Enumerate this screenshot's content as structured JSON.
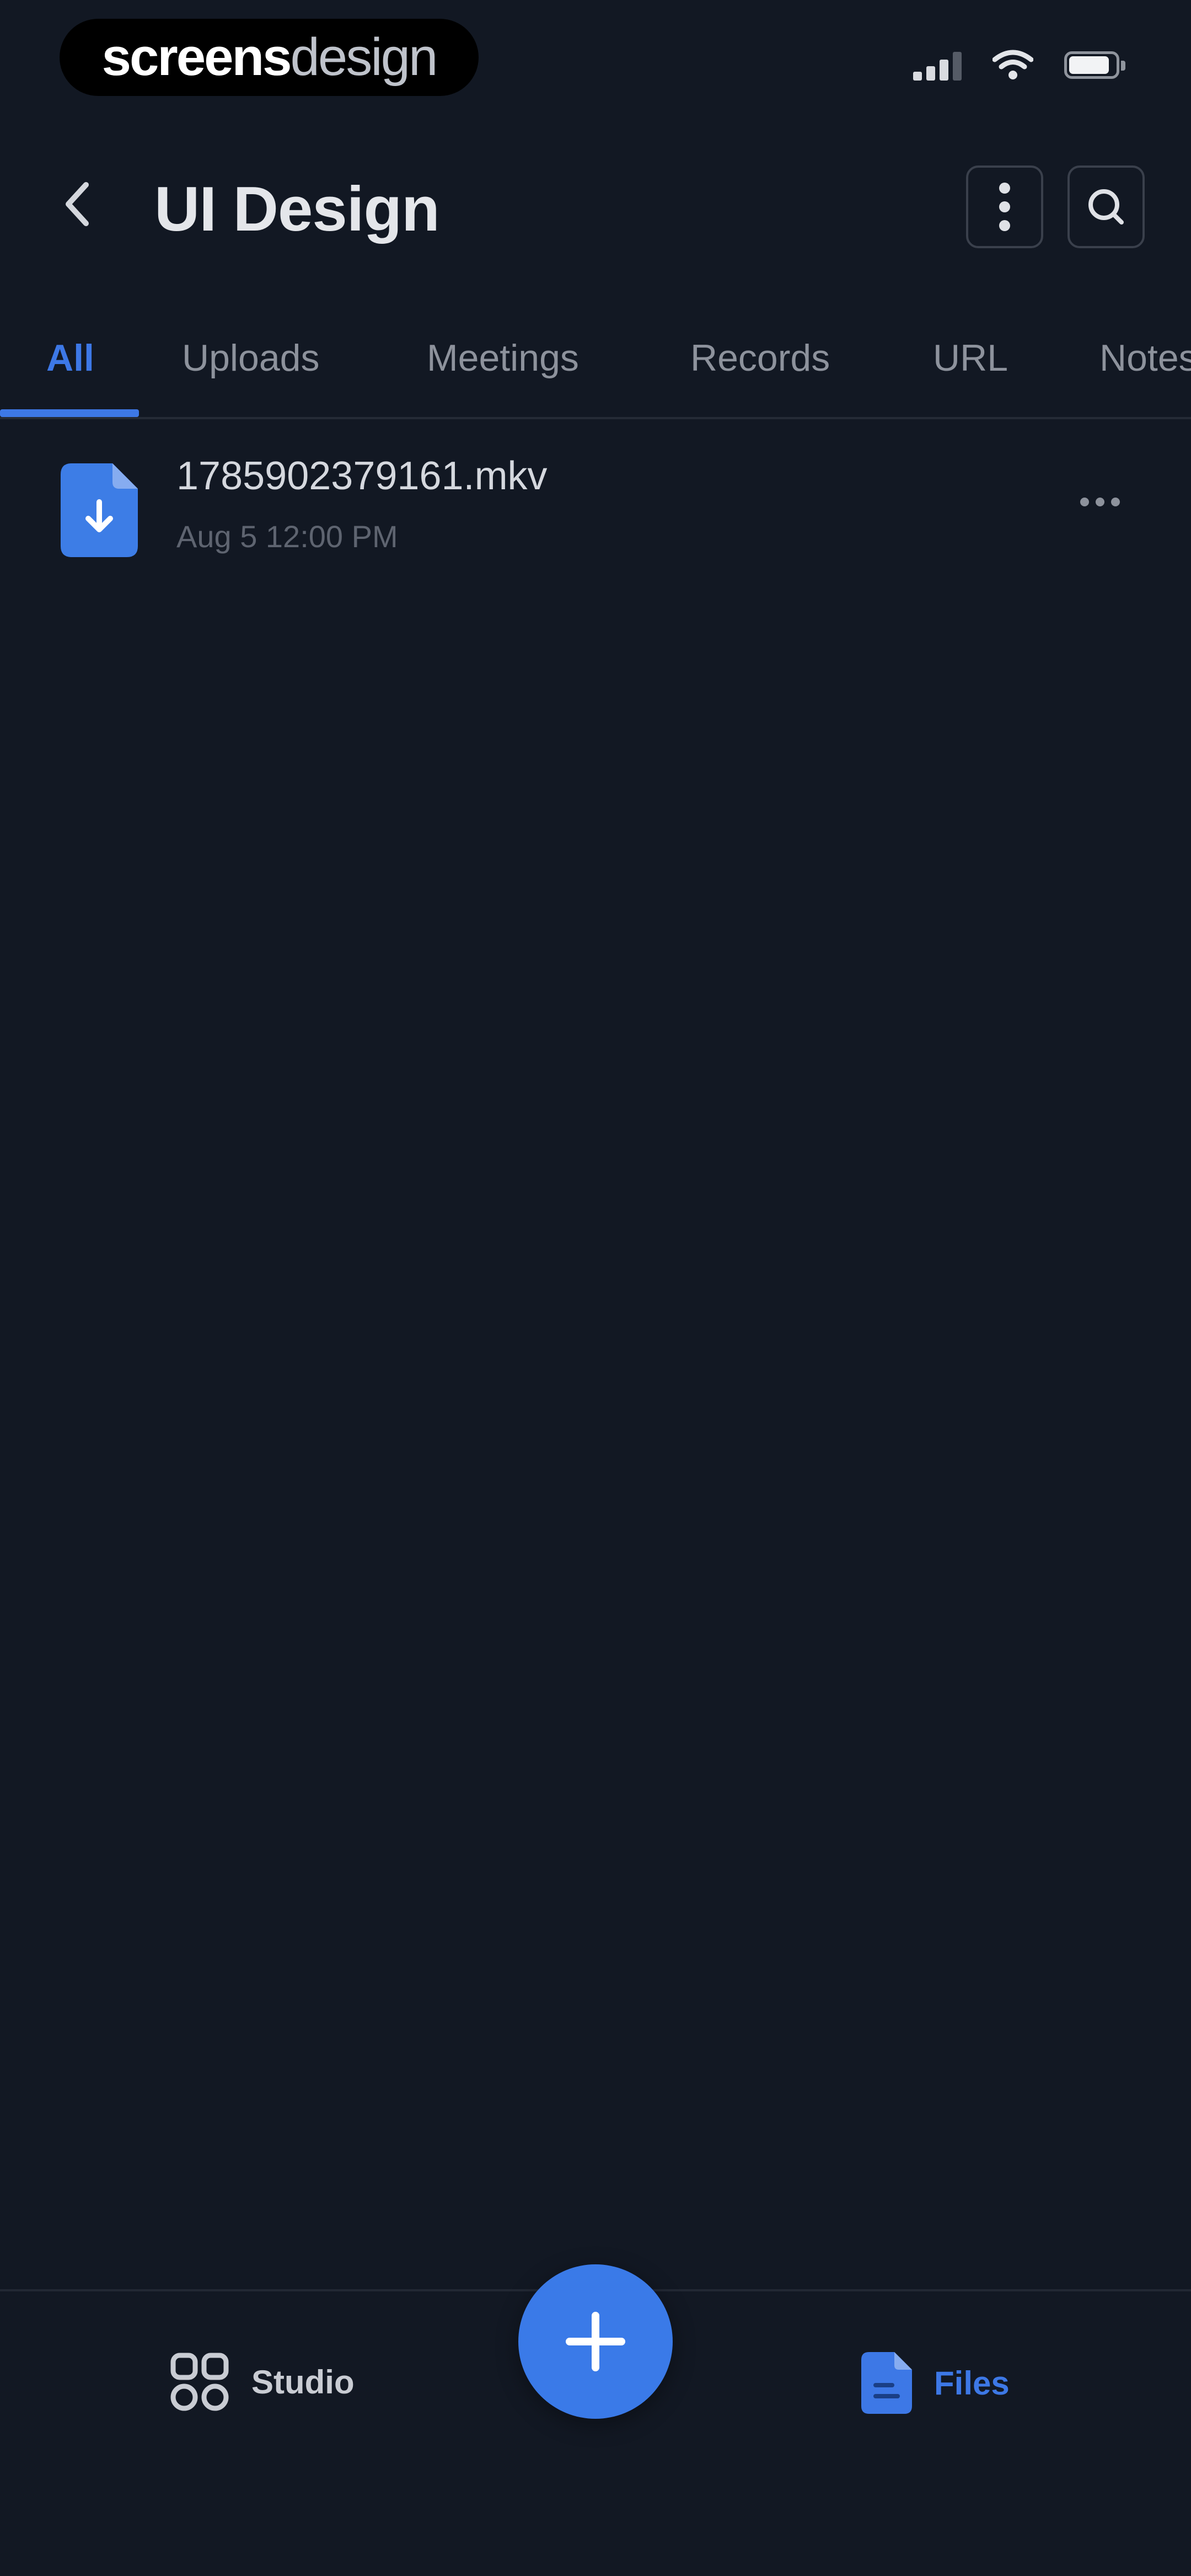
{
  "status_bar": {
    "brand_bold": "screens",
    "brand_light": "design",
    "icons": [
      "signal-icon",
      "wifi-icon",
      "battery-icon"
    ]
  },
  "header": {
    "title": "UI Design",
    "icons": [
      "chevron-left-icon",
      "more-vertical-icon",
      "search-icon"
    ]
  },
  "tabs": [
    {
      "label": "All",
      "active": true
    },
    {
      "label": "Uploads",
      "active": false
    },
    {
      "label": "Meetings",
      "active": false
    },
    {
      "label": "Records",
      "active": false
    },
    {
      "label": "URL",
      "active": false
    },
    {
      "label": "Notes",
      "active": false
    }
  ],
  "files": [
    {
      "name": "1785902379161.mkv",
      "meta": "Aug 5 12:00 PM",
      "icon": "video-file-icon"
    }
  ],
  "bottom_nav": {
    "studio_label": "Studio",
    "files_label": "Files",
    "fab_icon": "plus-icon"
  },
  "colors": {
    "background": "#121823",
    "accent": "#3d78e6",
    "text_primary": "#e4e6ea",
    "text_secondary": "#8d929c"
  }
}
